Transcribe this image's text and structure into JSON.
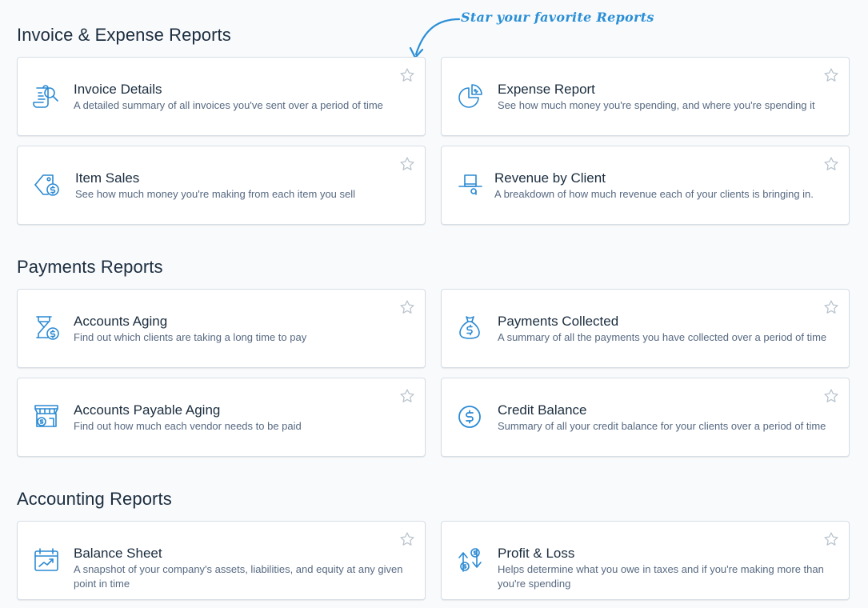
{
  "callout": {
    "text": "Star your favorite Reports"
  },
  "sections": [
    {
      "title": "Invoice & Expense Reports",
      "cards": [
        {
          "title": "Invoice Details",
          "desc": "A detailed summary of all invoices you've sent over a period of time",
          "icon": "invoice-search-icon"
        },
        {
          "title": "Expense Report",
          "desc": "See how much money you're spending, and where you're spending it",
          "icon": "pie-chart-icon"
        },
        {
          "title": "Item Sales",
          "desc": "See how much money you're making from each item you sell",
          "icon": "price-tag-icon"
        },
        {
          "title": "Revenue by Client",
          "desc": "A breakdown of how much revenue each of your clients is bringing in.",
          "icon": "top-hat-icon"
        }
      ]
    },
    {
      "title": "Payments Reports",
      "cards": [
        {
          "title": "Accounts Aging",
          "desc": "Find out which clients are taking a long time to pay",
          "icon": "hourglass-icon"
        },
        {
          "title": "Payments Collected",
          "desc": "A summary of all the payments you have collected over a period of time",
          "icon": "money-bag-icon"
        },
        {
          "title": "Accounts Payable Aging",
          "desc": "Find out how much each vendor needs to be paid",
          "icon": "storefront-icon"
        },
        {
          "title": "Credit Balance",
          "desc": "Summary of all your credit balance for your clients over a period of time",
          "icon": "dollar-circle-icon"
        }
      ]
    },
    {
      "title": "Accounting Reports",
      "cards": [
        {
          "title": "Balance Sheet",
          "desc": "A snapshot of your company's assets, liabilities, and equity at any given point in time",
          "icon": "calendar-chart-icon"
        },
        {
          "title": "Profit & Loss",
          "desc": "Helps determine what you owe in taxes and if you're making more than you're spending",
          "icon": "profit-loss-arrows-icon"
        }
      ]
    }
  ],
  "colors": {
    "accent": "#2a8fd6",
    "icon": "#2b8ad3",
    "star": "#b7c2cc",
    "border": "#d6dde4"
  }
}
